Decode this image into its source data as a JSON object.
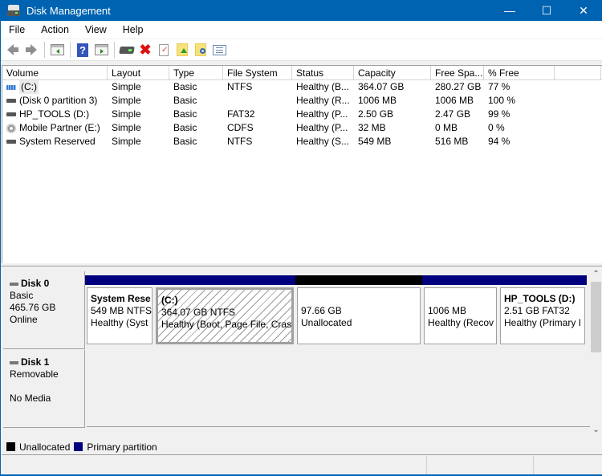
{
  "window": {
    "title": "Disk Management",
    "controls": {
      "minimize": "—",
      "maximize": "☐",
      "close": "✕"
    }
  },
  "menu": [
    "File",
    "Action",
    "View",
    "Help"
  ],
  "toolbar": {
    "buttons": [
      "back",
      "forward",
      "show-hide-console-tree",
      "help",
      "show-hide-action-pane",
      "connect-disk",
      "delete",
      "properties",
      "export-list",
      "find",
      "settings"
    ]
  },
  "volume_list": {
    "columns": [
      "Volume",
      "Layout",
      "Type",
      "File System",
      "Status",
      "Capacity",
      "Free Spa...",
      "% Free",
      ""
    ],
    "rows": [
      {
        "volume": "(C:)",
        "icon": "striped-drive",
        "layout": "Simple",
        "type": "Basic",
        "fs": "NTFS",
        "status": "Healthy (B...",
        "capacity": "364.07 GB",
        "free": "280.27 GB",
        "pct_free": "77 %"
      },
      {
        "volume": "(Disk 0 partition 3)",
        "icon": "drive",
        "layout": "Simple",
        "type": "Basic",
        "fs": "",
        "status": "Healthy (R...",
        "capacity": "1006 MB",
        "free": "1006 MB",
        "pct_free": "100 %"
      },
      {
        "volume": "HP_TOOLS (D:)",
        "icon": "drive",
        "layout": "Simple",
        "type": "Basic",
        "fs": "FAT32",
        "status": "Healthy (P...",
        "capacity": "2.50 GB",
        "free": "2.47 GB",
        "pct_free": "99 %"
      },
      {
        "volume": "Mobile Partner (E:)",
        "icon": "cd-drive",
        "layout": "Simple",
        "type": "Basic",
        "fs": "CDFS",
        "status": "Healthy (P...",
        "capacity": "32 MB",
        "free": "0 MB",
        "pct_free": "0 %"
      },
      {
        "volume": "System Reserved",
        "icon": "drive",
        "layout": "Simple",
        "type": "Basic",
        "fs": "NTFS",
        "status": "Healthy (S...",
        "capacity": "549 MB",
        "free": "516 MB",
        "pct_free": "94 %"
      }
    ]
  },
  "disks": [
    {
      "name": "Disk 0",
      "type": "Basic",
      "size": "465.76 GB",
      "state": "Online",
      "partitions": [
        {
          "name": "System Rese",
          "line1": "549 MB NTFS",
          "line2": "Healthy (Syst",
          "kind": "primary",
          "selected": false
        },
        {
          "name": "(C:)",
          "line1": "364.07 GB NTFS",
          "line2": "Healthy (Boot, Page File, Crash",
          "kind": "primary",
          "selected": true
        },
        {
          "name": "",
          "line1": "97.66 GB",
          "line2": "Unallocated",
          "kind": "unallocated",
          "selected": false
        },
        {
          "name": "",
          "line1": "1006 MB",
          "line2": "Healthy (Recov",
          "kind": "primary",
          "selected": false
        },
        {
          "name": "HP_TOOLS  (D:)",
          "line1": "2.51 GB FAT32",
          "line2": "Healthy (Primary I",
          "kind": "primary",
          "selected": false
        }
      ]
    },
    {
      "name": "Disk 1",
      "type": "Removable",
      "size": "",
      "state": "No Media"
    }
  ],
  "legend": [
    {
      "label": "Unallocated",
      "color": "#000000"
    },
    {
      "label": "Primary partition",
      "color": "#00007e"
    }
  ],
  "colors": {
    "titlebar": "#0063b1",
    "primary": "#00007e",
    "unallocated": "#000000"
  }
}
